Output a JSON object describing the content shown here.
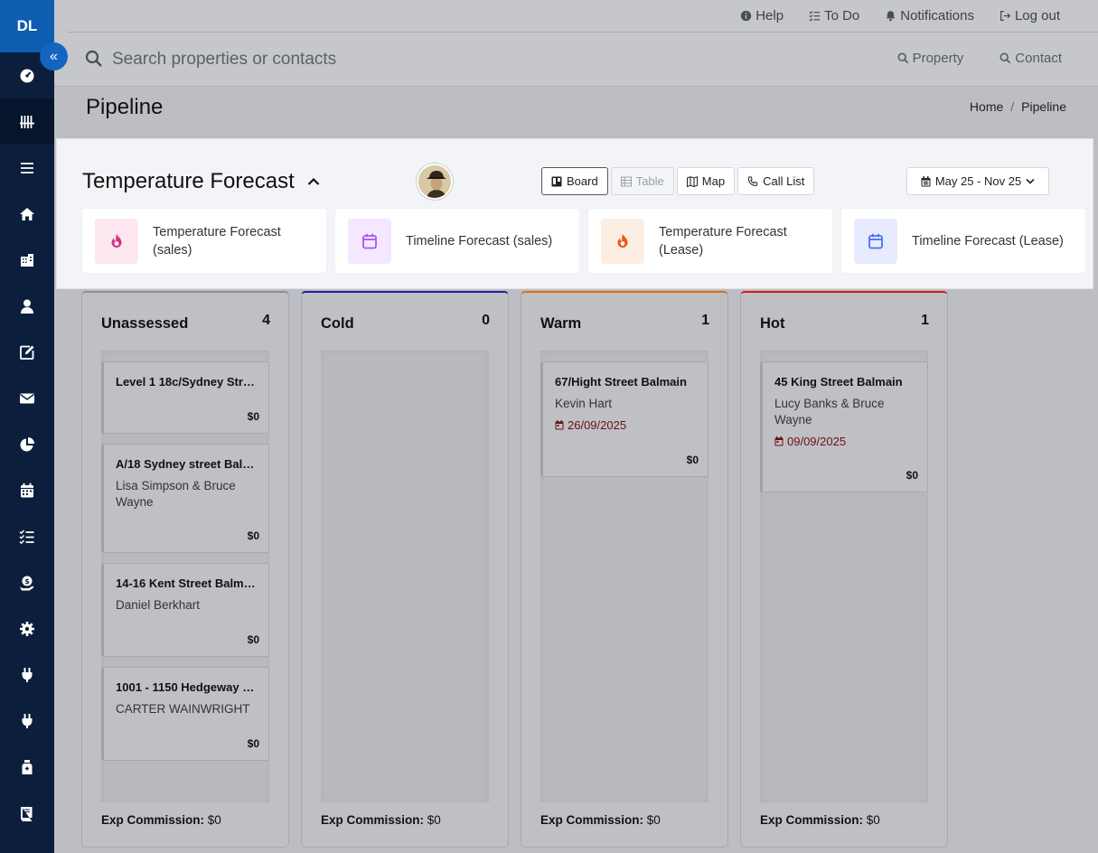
{
  "sidebar": {
    "brand": "DL",
    "collapse_glyph": "«",
    "items": [
      {
        "icon": "dashboard-icon"
      },
      {
        "icon": "pipeline-icon",
        "active": true
      },
      {
        "icon": "list-icon"
      },
      {
        "icon": "home-icon"
      },
      {
        "icon": "building-icon"
      },
      {
        "icon": "user-icon"
      },
      {
        "icon": "edit-icon"
      },
      {
        "icon": "mail-icon"
      },
      {
        "icon": "pie-chart-icon"
      },
      {
        "icon": "calendar-icon"
      },
      {
        "icon": "checklist-icon"
      },
      {
        "icon": "money-icon"
      },
      {
        "icon": "gear-icon"
      },
      {
        "icon": "plug-icon"
      },
      {
        "icon": "plug-icon"
      },
      {
        "icon": "bottle-icon"
      },
      {
        "icon": "book-icon"
      }
    ]
  },
  "topbar": {
    "help": "Help",
    "todo": "To Do",
    "notifications": "Notifications",
    "logout": "Log out"
  },
  "search": {
    "placeholder": "Search properties or contacts",
    "property": "Property",
    "contact": "Contact"
  },
  "page": {
    "title": "Pipeline",
    "breadcrumb_home": "Home",
    "breadcrumb_sep": "/",
    "breadcrumb_current": "Pipeline"
  },
  "forecast": {
    "title": "Temperature Forecast",
    "views": {
      "board": "Board",
      "table": "Table",
      "map": "Map",
      "call_list": "Call List"
    },
    "date_range": "May 25 - Nov 25",
    "cards": [
      {
        "label": "Temperature Forecast (sales)",
        "icon": "fire-icon",
        "color": "#d63384",
        "bg": "#fde7f1"
      },
      {
        "label": "Timeline Forecast (sales)",
        "icon": "calendar-icon",
        "color": "#a855f7",
        "bg": "#f3e8ff"
      },
      {
        "label": "Temperature Forecast (Lease)",
        "icon": "fire-icon",
        "color": "#e8590c",
        "bg": "#fdeee4"
      },
      {
        "label": "Timeline Forecast (Lease)",
        "icon": "calendar-icon",
        "color": "#4c6ef5",
        "bg": "#e7ebfd"
      }
    ]
  },
  "commission_label": "Exp Commission:",
  "columns": [
    {
      "name": "Unassessed",
      "count": "4",
      "accent": "#8f9094",
      "commission": "$0",
      "cards": [
        {
          "title": "Level 1 18c/Sydney Street...",
          "contact": "",
          "date": "",
          "value": "$0"
        },
        {
          "title": "A/18 Sydney street Balma...",
          "contact": "Lisa Simpson & Bruce Wayne",
          "date": "",
          "value": "$0"
        },
        {
          "title": "14-16 Kent Street Balmain",
          "contact": "Daniel Berkhart",
          "date": "",
          "value": "$0"
        },
        {
          "title": "1001 - 1150 Hedgeway Dr...",
          "contact": "CARTER WAINWRIGHT",
          "date": "",
          "value": "$0"
        }
      ]
    },
    {
      "name": "Cold",
      "count": "0",
      "accent": "#1c1ca8",
      "commission": "$0",
      "cards": []
    },
    {
      "name": "Warm",
      "count": "1",
      "accent": "#d9730d",
      "commission": "$0",
      "cards": [
        {
          "title": "67/Hight Street Balmain",
          "contact": "Kevin Hart",
          "date": "26/09/2025",
          "value": "$0"
        }
      ]
    },
    {
      "name": "Hot",
      "count": "1",
      "accent": "#d11a1a",
      "commission": "$0",
      "cards": [
        {
          "title": "45 King Street Balmain",
          "contact": "Lucy Banks & Bruce Wayne",
          "date": "09/09/2025",
          "value": "$0"
        }
      ]
    }
  ]
}
